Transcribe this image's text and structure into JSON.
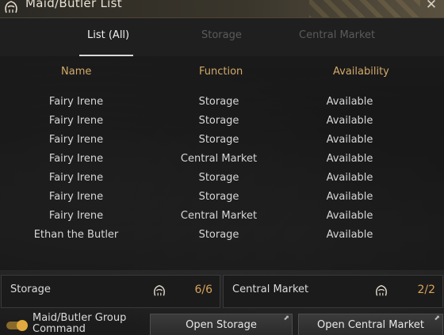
{
  "window": {
    "title": "Maid/Butler List",
    "close_glyph": "✕"
  },
  "tabs": [
    {
      "label": "List (All)",
      "active": true
    },
    {
      "label": "Storage",
      "active": false
    },
    {
      "label": "Central Market",
      "active": false
    }
  ],
  "table": {
    "headers": {
      "name": "Name",
      "function": "Function",
      "availability": "Availability"
    },
    "rows": [
      {
        "name": "Fairy Irene",
        "function": "Storage",
        "availability": "Available"
      },
      {
        "name": "Fairy Irene",
        "function": "Storage",
        "availability": "Available"
      },
      {
        "name": "Fairy Irene",
        "function": "Storage",
        "availability": "Available"
      },
      {
        "name": "Fairy Irene",
        "function": "Central Market",
        "availability": "Available"
      },
      {
        "name": "Fairy Irene",
        "function": "Storage",
        "availability": "Available"
      },
      {
        "name": "Fairy Irene",
        "function": "Storage",
        "availability": "Available"
      },
      {
        "name": "Fairy Irene",
        "function": "Central Market",
        "availability": "Available"
      },
      {
        "name": "Ethan the Butler",
        "function": "Storage",
        "availability": "Available"
      }
    ]
  },
  "summary": {
    "storage": {
      "label": "Storage",
      "count": "6/6",
      "icon": "maid-icon"
    },
    "market": {
      "label": "Central Market",
      "count": "2/2",
      "icon": "maid-icon"
    }
  },
  "footer": {
    "toggle_label": "Maid/Butler Group Command",
    "toggle_on": true,
    "open_storage": "Open Storage",
    "open_market": "Open Central Market",
    "external_glyph": "⬈"
  },
  "colors": {
    "accent_gold": "#d7a25a",
    "header_gold": "#d2aa6a"
  }
}
